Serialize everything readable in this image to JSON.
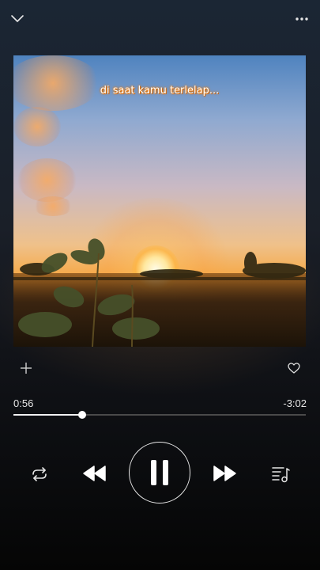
{
  "header": {
    "collapse_icon": "chevron-down-icon",
    "more_icon": "more-horizontal-icon"
  },
  "artwork": {
    "caption": "di saat kamu terlelap..."
  },
  "actions": {
    "add_icon": "plus-icon",
    "like_icon": "heart-outline-icon"
  },
  "playback": {
    "elapsed": "0:56",
    "remaining": "-3:02",
    "progress_fraction": 0.2355
  },
  "controls": {
    "repeat_icon": "repeat-icon",
    "previous_icon": "rewind-icon",
    "play_pause_icon": "pause-icon",
    "next_icon": "fast-forward-icon",
    "queue_icon": "queue-list-icon"
  },
  "colors": {
    "text": "#e6e6e6",
    "progress_fill": "#f2f2f2",
    "progress_track": "#4a4a4a",
    "caption_glow": "#f07a00"
  }
}
